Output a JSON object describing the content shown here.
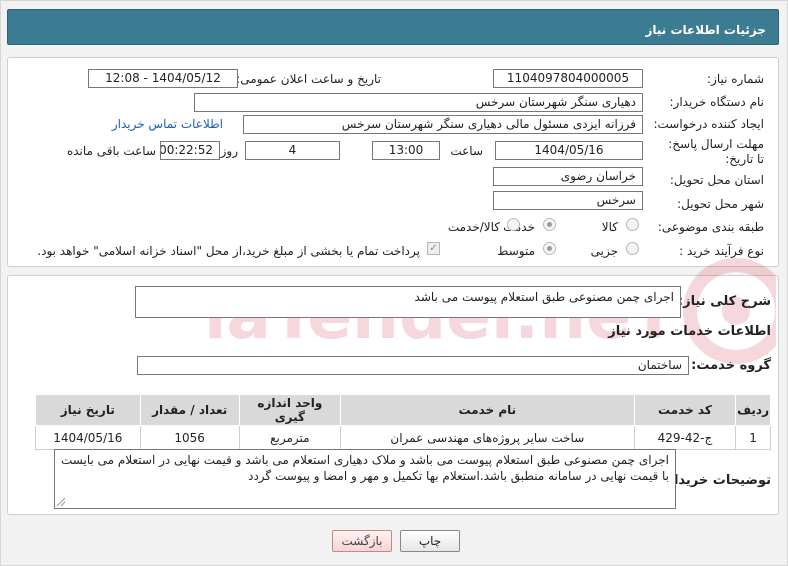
{
  "header": {
    "title": "جزئیات اطلاعات نیاز"
  },
  "form": {
    "need_number_label": "شماره نیاز:",
    "need_number": "1104097804000005",
    "announce_label": "تاریخ و ساعت اعلان عمومی:",
    "announce_value": "1404/05/12 - 12:08",
    "buyer_org_label": "نام دستگاه خریدار:",
    "buyer_org": "دهیاری سنگر شهرستان سرخس",
    "requester_label": "ایجاد کننده درخواست:",
    "requester": "فرزانه ایزدی مسئول مالی دهیاری سنگر شهرستان سرخس",
    "contact_link": "اطلاعات تماس خریدار",
    "deadline_label": "مهلت ارسال پاسخ: تا تاریخ:",
    "deadline_date": "1404/05/16",
    "time_label": "ساعت",
    "deadline_time": "13:00",
    "days_value": "4",
    "days_label": "روز و",
    "remaining_time": "00:22:52",
    "remaining_label": "ساعت باقی مانده",
    "province_label": "استان محل تحویل:",
    "province": "خراسان رضوی",
    "city_label": "شهر محل تحویل:",
    "city": "سرخس",
    "category_label": "طبقه بندی موضوعی:",
    "category_options": [
      "کالا",
      "خدمت",
      "کالا/خدمت"
    ],
    "category_selected": "خدمت",
    "process_label": "نوع فرآیند خرید :",
    "process_options": [
      "جزیی",
      "متوسط"
    ],
    "process_selected": "متوسط",
    "payment_note": "پرداخت تمام یا بخشی از مبلغ خرید،از محل \"اسناد خزانه اسلامی\" خواهد بود."
  },
  "summary": {
    "label": "شرح کلی نیاز:",
    "value": "اجرای چمن مصنوعی طبق استعلام پیوست می باشد"
  },
  "services": {
    "section_title": "اطلاعات خدمات مورد نیاز",
    "group_label": "گروه خدمت:",
    "group_value": "ساختمان",
    "columns": [
      "ردیف",
      "کد خدمت",
      "نام خدمت",
      "واحد اندازه گیری",
      "تعداد / مقدار",
      "تاریخ نیاز"
    ],
    "rows": [
      [
        "1",
        "ج-42-429",
        "ساخت سایر پروژه‌های مهندسی عمران",
        "مترمربع",
        "1056",
        "1404/05/16"
      ]
    ]
  },
  "buyer_notes": {
    "label": "توضیحات خریدار:",
    "value": "اجرای چمن مصنوعی طبق استعلام پیوست می باشد و ملاک دهیاری استعلام می باشد و قیمت نهایی در استعلام می بایست با قیمت نهایی در سامانه منطبق باشد.استعلام بها تکمیل و مهر و امضا و پیوست گردد"
  },
  "buttons": {
    "print": "چاپ",
    "back": "بازگشت"
  },
  "watermark": {
    "text": "AriaTender.neT"
  },
  "colors": {
    "header": "#3b7c93",
    "link": "#1a5fb4",
    "back_button": "#f6d4d4",
    "watermark": "#c8102e"
  }
}
